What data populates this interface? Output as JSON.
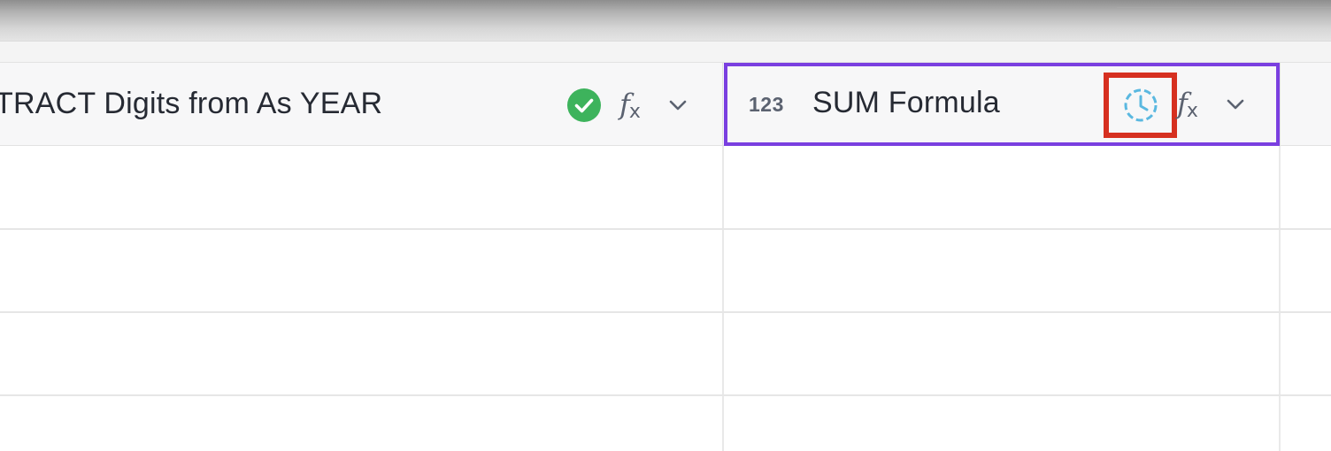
{
  "columns": [
    {
      "title": "TRACT Digits from As YEAR",
      "status_icon": "check-circle-icon",
      "status_color": "#3db35c",
      "formula_icon": "fx-icon",
      "menu_icon": "chevron-down-icon"
    },
    {
      "title": "SUM Formula",
      "type_label": "123",
      "type_icon": "number-type-icon",
      "status_icon": "clock-pending-icon",
      "status_color": "#5ab8e0",
      "formula_icon": "fx-icon",
      "menu_icon": "chevron-down-icon",
      "selected": true
    }
  ],
  "fx": {
    "f": "f",
    "x": "x"
  },
  "colors": {
    "selection": "#7a3fe0",
    "highlight": "#d63020",
    "header_bg": "#f7f7f8"
  },
  "rows": [
    {
      "cells": [
        "",
        ""
      ]
    },
    {
      "cells": [
        "",
        ""
      ]
    },
    {
      "cells": [
        "",
        ""
      ]
    },
    {
      "cells": [
        "",
        ""
      ]
    }
  ]
}
